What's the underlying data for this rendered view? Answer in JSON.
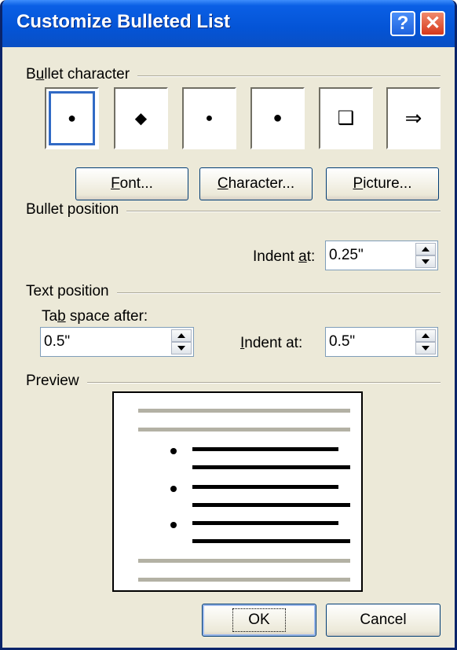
{
  "window": {
    "title": "Customize Bulleted List",
    "help_glyph": "?",
    "close_glyph": "✕"
  },
  "bullet_character": {
    "label": "Bullet character",
    "mnemonic_prefix": "B",
    "mnemonic_char": "u",
    "mnemonic_rest": "llet character",
    "bullets": [
      {
        "glyph": "●",
        "selected": true
      },
      {
        "glyph": "◆",
        "selected": false
      },
      {
        "glyph": "●",
        "selected": false
      },
      {
        "glyph": "●",
        "selected": false
      },
      {
        "glyph": "❑",
        "selected": false
      },
      {
        "glyph": "⇒",
        "selected": false
      }
    ],
    "buttons": {
      "font": {
        "m": "F",
        "rest": "ont..."
      },
      "character": {
        "m": "C",
        "rest": "haracter..."
      },
      "picture": {
        "m": "P",
        "rest": "icture..."
      }
    }
  },
  "bullet_position": {
    "label": "Bullet position",
    "indent_label_pre": "Indent ",
    "indent_label_m": "a",
    "indent_label_post": "t:",
    "indent_value": "0.25\""
  },
  "text_position": {
    "label": "Text position",
    "tab_label_pre": "Ta",
    "tab_label_m": "b",
    "tab_label_post": " space after:",
    "tab_value": "0.5\"",
    "indent_label_m": "I",
    "indent_label_post": "ndent at:",
    "indent_value": "0.5\""
  },
  "preview": {
    "label": "Preview"
  },
  "actions": {
    "ok": "OK",
    "cancel": "Cancel"
  },
  "colors": {
    "titlebar": "#0454d6",
    "dialog_bg": "#ece9d8",
    "selection": "#316ac5"
  }
}
